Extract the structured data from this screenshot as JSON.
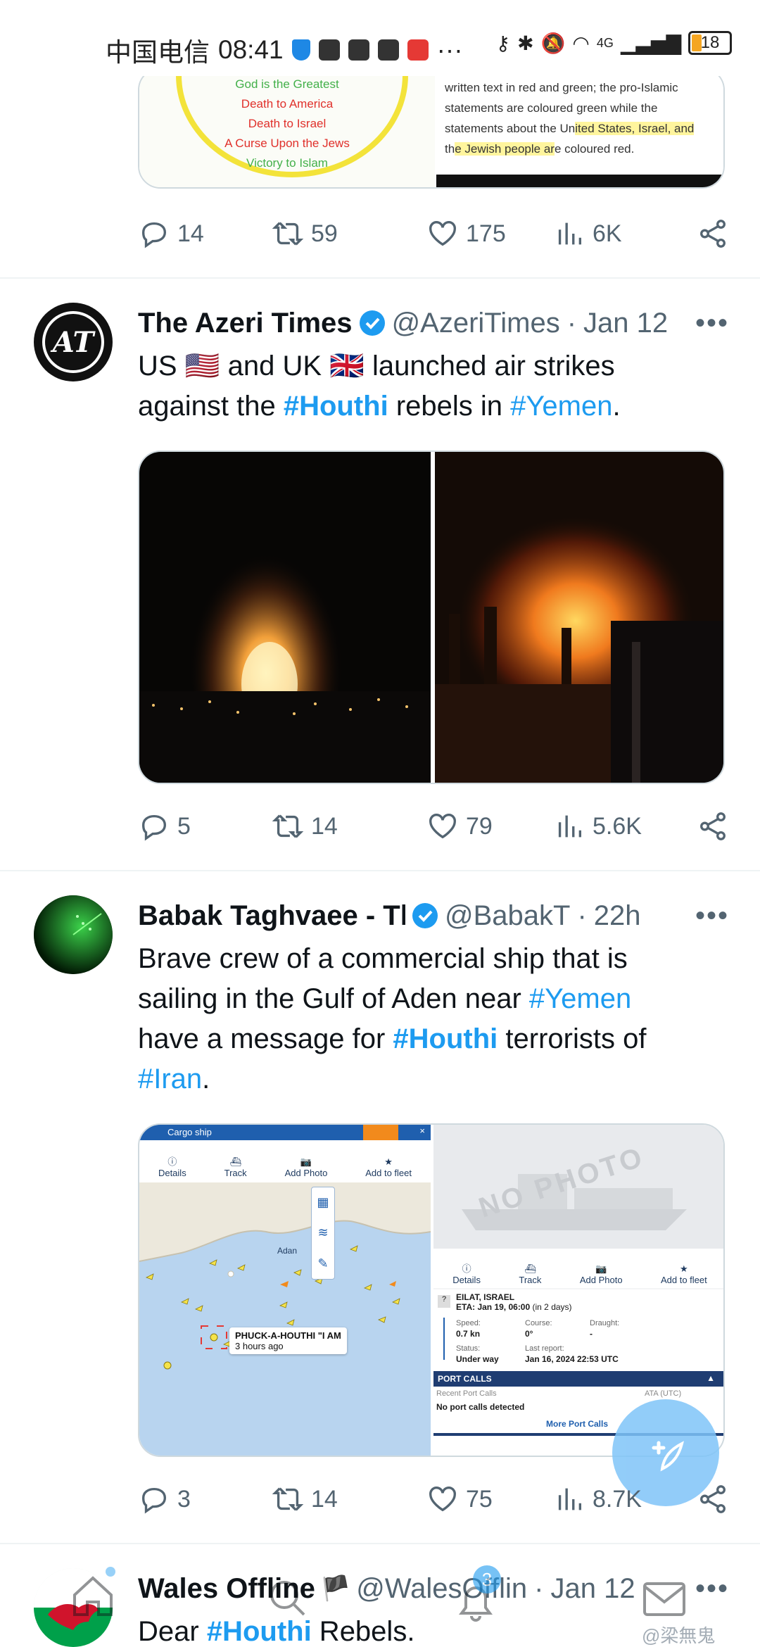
{
  "status_bar": {
    "carrier": "中国电信",
    "time": "08:41",
    "network": "4G",
    "battery": "18"
  },
  "prev_tweet": {
    "image_left_lines": [
      "God is the Greatest",
      "Death to America",
      "Death to Israel",
      "A Curse Upon the Jews",
      "Victory to Islam"
    ],
    "image_right_line1": "written text in red and green; the pro-Islamic",
    "image_right_line2": "statements are coloured green while the",
    "image_right_line3a": "statements about the Un",
    "image_right_line3b": "ited States, Israel, and",
    "image_right_line4a": "th",
    "image_right_line4b": "e Jewish people ar",
    "image_right_line4c": "e coloured red.",
    "replies": "14",
    "reposts": "59",
    "likes": "175",
    "views": "6K"
  },
  "tweet1": {
    "name": "The Azeri Times",
    "handle": "@AzeriTimes",
    "time": "Jan 12",
    "text_a": "US 🇺🇸 and UK 🇬🇧 launched air strikes",
    "text_b": "against the ",
    "tag1": "#Houthi",
    "text_c": " rebels in ",
    "tag2": "#Yemen",
    "text_d": ".",
    "replies": "5",
    "reposts": "14",
    "likes": "79",
    "views": "5.6K"
  },
  "tweet2": {
    "name": "Babak Taghvaee - Th",
    "handle": "@BabakT",
    "time": "22h",
    "line1": "Brave crew of a commercial ship that is",
    "line2a": "sailing in the Gulf of Aden near ",
    "line2tag": "#Yemen",
    "line3a": "have a message for ",
    "line3tag": "#Houthi",
    "line3b": " terrorists of",
    "line4tag": "#Iran",
    "line4b": ".",
    "map": {
      "header": "Cargo ship",
      "tabs": [
        "Details",
        "Track",
        "Add Photo",
        "Add to fleet"
      ],
      "place": "Adan",
      "ship_label": "PHUCK-A-HOUTHI \"I AM",
      "ship_time": "3 hours ago",
      "no_photo": "NO PHOTO",
      "dest": "EILAT, ISRAEL",
      "eta": "ETA: Jan 19, 06:00",
      "eta_note": "(in 2 days)",
      "speed_label": "Speed:",
      "speed": "0.7 kn",
      "course_label": "Course:",
      "course": "0°",
      "draught_label": "Draught:",
      "draught": "-",
      "status_label": "Status:",
      "status": "Under way",
      "report_label": "Last report:",
      "report": "Jan 16, 2024 22:53 UTC",
      "port_calls": "PORT CALLS",
      "recent_label": "Recent Port Calls",
      "ata_label": "ATA (UTC)",
      "no_calls": "No port calls detected",
      "more": "More Port Calls"
    },
    "replies": "3",
    "reposts": "14",
    "likes": "75",
    "views": "8.7K"
  },
  "tweet3": {
    "name": "Wales Offline",
    "handle": "@WalesOfflin",
    "time": "Jan 12",
    "text_a": "Dear ",
    "tag": "#Houthi",
    "text_b": " Rebels."
  },
  "bottom_nav": {
    "notification_count": "3",
    "watermark": "@梁無鬼"
  },
  "colors": {
    "link": "#1d9bf0",
    "verified": "#1d9bf0",
    "muted": "#536471"
  }
}
